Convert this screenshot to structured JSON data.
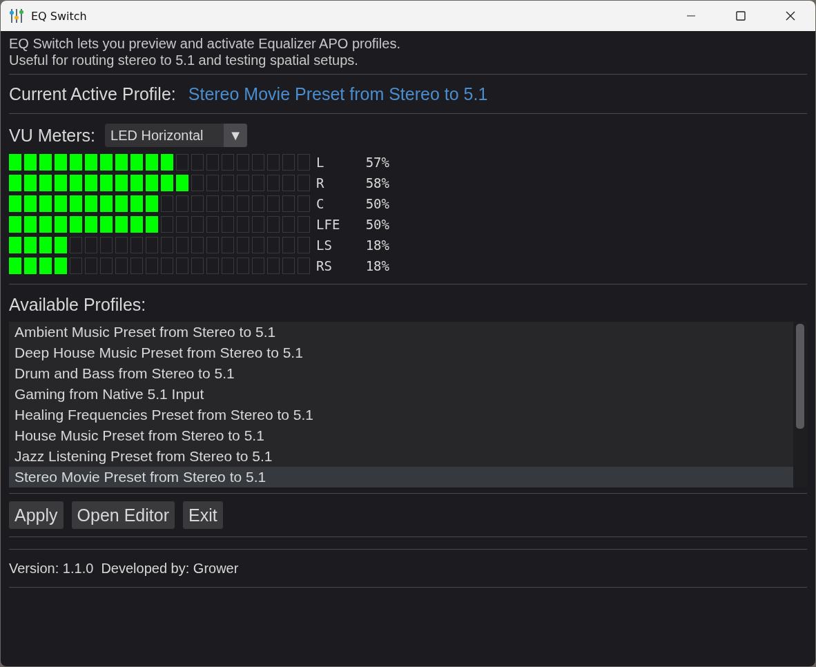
{
  "window": {
    "title": "EQ Switch"
  },
  "description": [
    "EQ Switch lets you preview and activate Equalizer APO profiles.",
    "Useful for routing stereo to 5.1 and testing spatial setups."
  ],
  "current_profile": {
    "label": "Current Active Profile:",
    "value": "Stereo Movie Preset from Stereo to 5.1"
  },
  "vu_meters": {
    "label": "VU Meters:",
    "mode": {
      "value": "LED Horizontal",
      "arrow": "▼"
    },
    "channels": [
      {
        "name": "L",
        "level": 0.55,
        "reading": "57%"
      },
      {
        "name": "R",
        "level": 0.6,
        "reading": "58%"
      },
      {
        "name": "C",
        "level": 0.5,
        "reading": "50%"
      },
      {
        "name": "LFE",
        "level": 0.5,
        "reading": "50%"
      },
      {
        "name": "LS",
        "level": 0.2,
        "reading": "18%"
      },
      {
        "name": "RS",
        "level": 0.2,
        "reading": "18%"
      }
    ]
  },
  "profiles": {
    "label": "Available Profiles:",
    "items": [
      {
        "label": "Ambient Music Preset from Stereo to 5.1",
        "selected": false
      },
      {
        "label": "Deep House Music Preset from Stereo to 5.1",
        "selected": false
      },
      {
        "label": "Drum and Bass from Stereo to 5.1",
        "selected": false
      },
      {
        "label": "Gaming from Native 5.1 Input",
        "selected": false
      },
      {
        "label": "Healing Frequencies Preset from Stereo to 5.1",
        "selected": false
      },
      {
        "label": "House Music Preset from Stereo to 5.1",
        "selected": false
      },
      {
        "label": "Jazz Listening Preset from Stereo to 5.1",
        "selected": false
      },
      {
        "label": "Stereo Movie Preset from Stereo to 5.1",
        "selected": true
      }
    ]
  },
  "buttons": [
    "Apply",
    "Open Editor",
    "Exit"
  ],
  "status_bar": {
    "text": "Version: 1.1.0  Developed by: Grower"
  }
}
